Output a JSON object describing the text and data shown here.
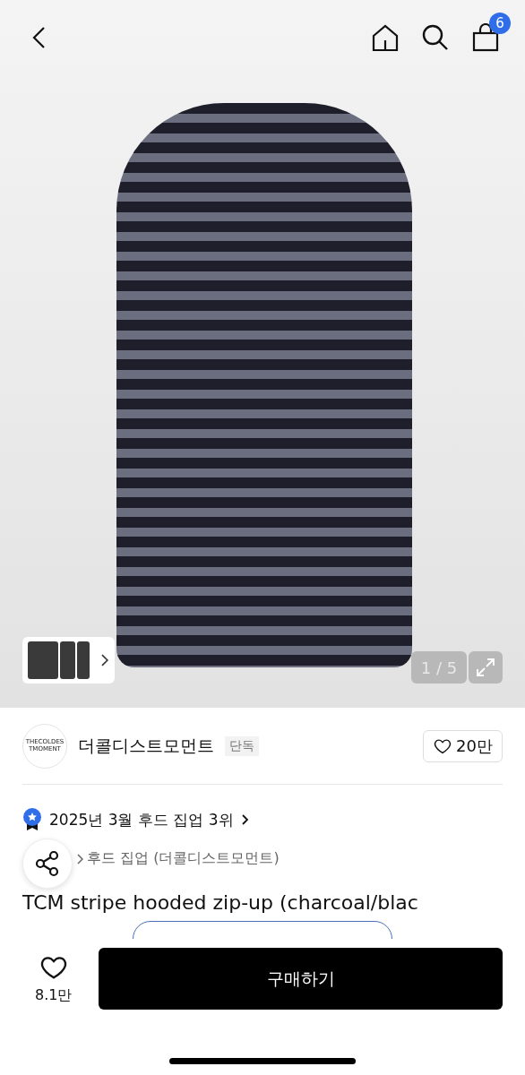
{
  "header": {
    "cart_count": "6"
  },
  "gallery": {
    "counter": "1 / 5"
  },
  "brand": {
    "name": "더콜디스트모먼트",
    "tag": "단독",
    "logo_text": "THECOLDESTMOMENT",
    "likes": "20만"
  },
  "ranking": {
    "text": "2025년 3월 후드 집업 3위"
  },
  "breadcrumb": {
    "text": "후드 집업 (더콜디스트모먼트)"
  },
  "product": {
    "title": "TCM stripe hooded zip-up (charcoal/blac"
  },
  "bottom_bar": {
    "likes": "8.1만",
    "buy_label": "구매하기"
  }
}
